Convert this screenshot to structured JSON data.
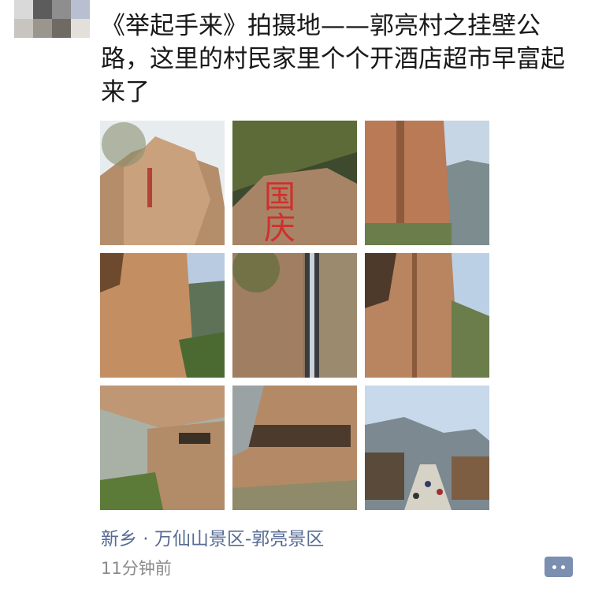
{
  "post": {
    "text": "《举起手来》拍摄地——郭亮村之挂壁公路，这里的村民家里个个开酒店超市早富起来了",
    "location": "新乡 · 万仙山景区-郭亮景区",
    "time": "11分钟前"
  },
  "photos": [
    {
      "subject": "inscribed-rock-cliff"
    },
    {
      "subject": "rock-with-red-characters"
    },
    {
      "subject": "cliff-and-mountains"
    },
    {
      "subject": "cliff-wall-valley"
    },
    {
      "subject": "gorge-waterfall"
    },
    {
      "subject": "cliff-cave-road"
    },
    {
      "subject": "tunnel-overhang"
    },
    {
      "subject": "cliff-tunnel-road"
    },
    {
      "subject": "village-street-tourists"
    }
  ],
  "colors": {
    "link": "#576b95",
    "time": "#8a8a8a",
    "text": "#191919",
    "action_button": "#7b8fb0"
  }
}
